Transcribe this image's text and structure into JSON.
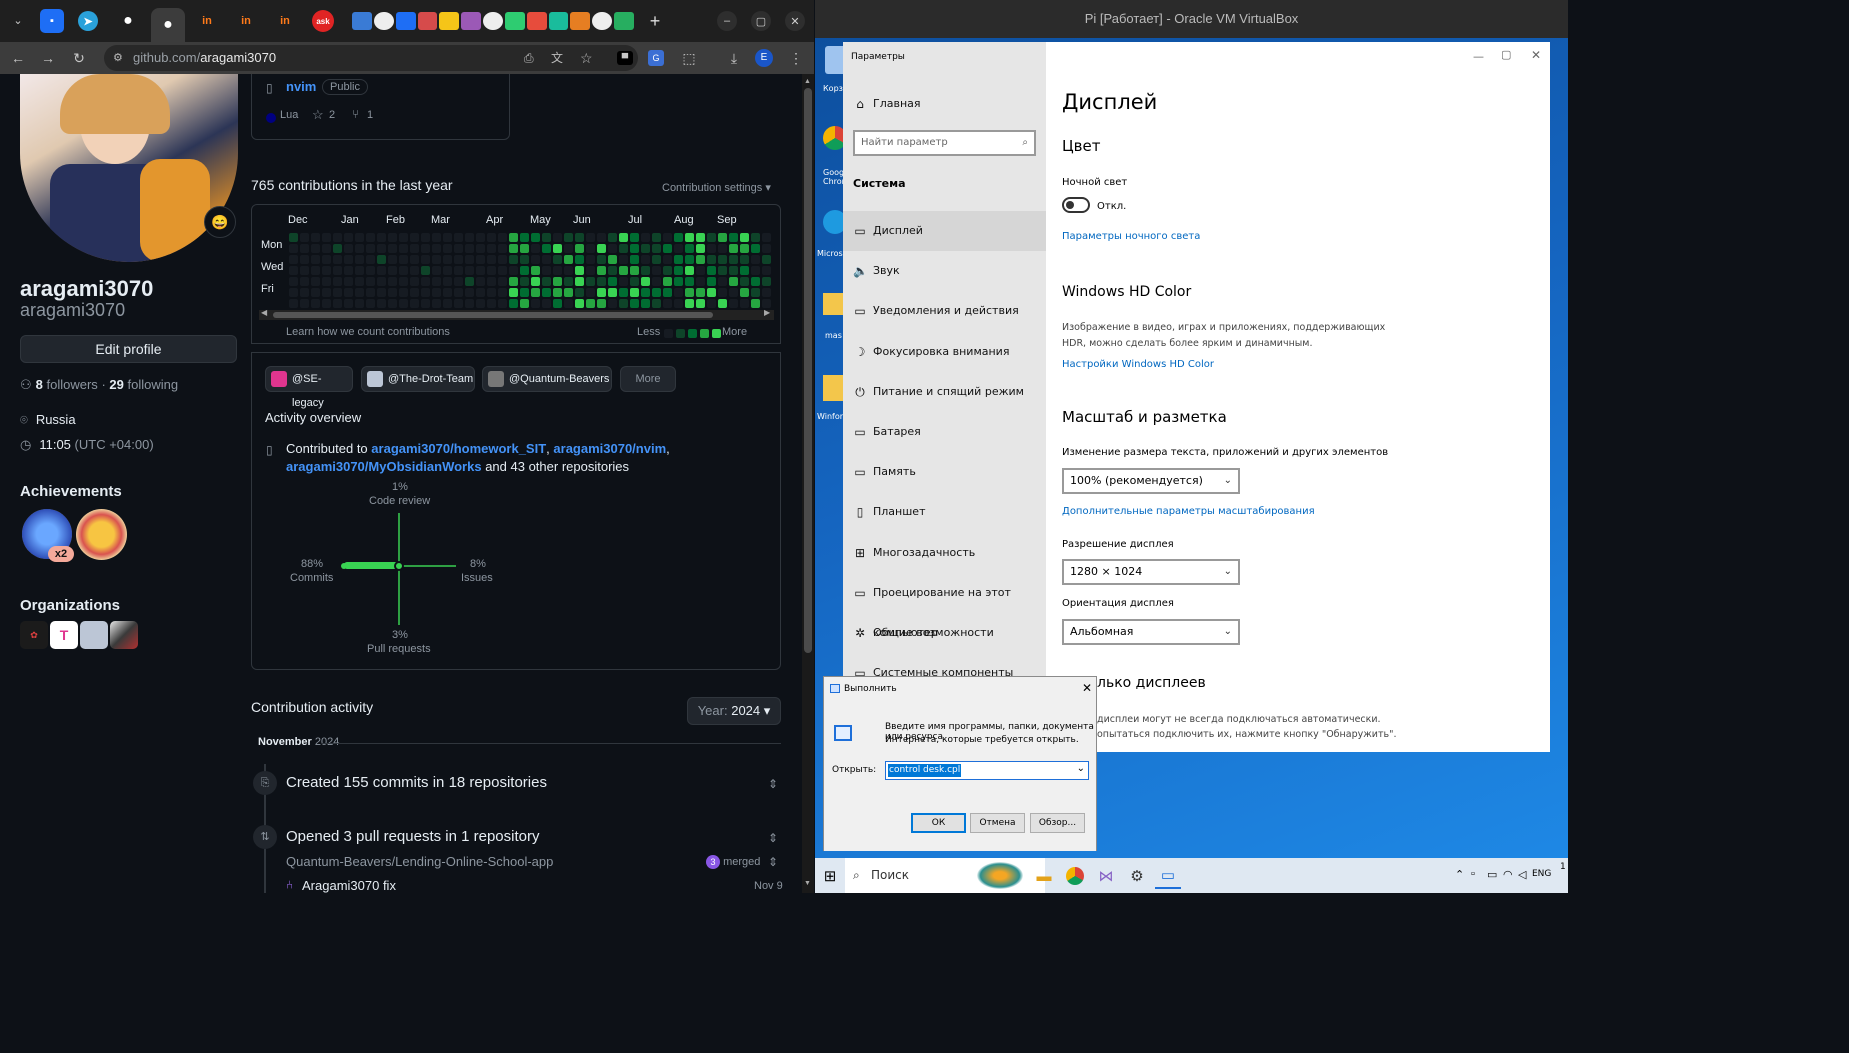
{
  "browser": {
    "url_host": "github.com/",
    "url_path": "aragami3070",
    "tab_favicons": [
      "chat",
      "telegram",
      "github",
      "github",
      "inf",
      "inf",
      "inf",
      "ask"
    ],
    "profile_initial": "E"
  },
  "pinned_repo": {
    "name": "nvim",
    "visibility": "Public",
    "language": "Lua",
    "stars": "2",
    "forks": "1"
  },
  "profile": {
    "name": "aragami3070",
    "login": "aragami3070",
    "edit_button": "Edit profile",
    "followers_count": "8",
    "followers_label": "followers",
    "separator": "·",
    "following_count": "29",
    "following_label": "following",
    "location": "Russia",
    "time": "11:05",
    "timezone": "(UTC +04:00)",
    "status_emoji": "😄"
  },
  "achievements": {
    "title": "Achievements",
    "badge_multiplier": "x2"
  },
  "organizations": {
    "title": "Organizations"
  },
  "contributions": {
    "summary": "765 contributions in the last year",
    "settings": "Contribution settings",
    "months": [
      "Dec",
      "Jan",
      "Feb",
      "Mar",
      "Apr",
      "May",
      "Jun",
      "Jul",
      "Aug",
      "Sep"
    ],
    "days": [
      "Mon",
      "Wed",
      "Fri"
    ],
    "learn_link": "Learn how we count contributions",
    "less": "Less",
    "more": "More"
  },
  "org_filters": [
    "@SE-legacy",
    "@The-Drot-Team",
    "@Quantum-Beavers"
  ],
  "org_more": "More",
  "activity_overview": {
    "title": "Activity overview",
    "contributed_prefix": "Contributed to",
    "repo1": "aragami3070/homework_SIT",
    "comma": ",",
    "repo2": "aragami3070/nvim",
    "repo3": "aragami3070/MyObsidianWorks",
    "suffix": "and 43 other repositories",
    "code_review_pct": "1%",
    "code_review_label": "Code review",
    "commits_pct": "88%",
    "commits_label": "Commits",
    "issues_pct": "8%",
    "issues_label": "Issues",
    "pr_pct": "3%",
    "pr_label": "Pull requests"
  },
  "contribution_activity": {
    "title": "Contribution activity",
    "year_prefix": "Year:",
    "year": "2024",
    "month": "November",
    "month_year": "2024",
    "item1": "Created 155 commits in 18 repositories",
    "item2": "Opened 3 pull requests in 1 repository",
    "repo": "Quantum-Beavers/Lending-Online-School-app",
    "merged_count": "3",
    "merged_label": "merged",
    "pr_title": "Aragami3070 fix",
    "pr_date": "Nov 9"
  },
  "vbox": {
    "title": "Pi [Работает] - Oracle VM VirtualBox",
    "desktop_icons": [
      "Корзи",
      "Googl Chrom",
      "Microso",
      "mas",
      "Winform"
    ]
  },
  "settings": {
    "window_title": "Параметры",
    "home": "Главная",
    "search_placeholder": "Найти параметр",
    "group": "Система",
    "nav": [
      "Дисплей",
      "Звук",
      "Уведомления и действия",
      "Фокусировка внимания",
      "Питание и спящий режим",
      "Батарея",
      "Память",
      "Планшет",
      "Многозадачность",
      "Проецирование на этот компьютер",
      "Общие возможности",
      "Системные компоненты"
    ],
    "page_title": "Дисплей",
    "color_heading": "Цвет",
    "night_light_label": "Ночной свет",
    "night_light_state": "Откл.",
    "night_light_link": "Параметры ночного света",
    "hdr_heading": "Windows HD Color",
    "hdr_desc1": "Изображение в видео, играх и приложениях, поддерживающих",
    "hdr_desc2": "HDR, можно сделать более ярким и динамичным.",
    "hdr_link": "Настройки Windows HD Color",
    "scale_heading": "Масштаб и разметка",
    "scale_label": "Изменение размера текста, приложений и других элементов",
    "scale_value": "100% (рекомендуется)",
    "scale_link": "Дополнительные параметры масштабирования",
    "resolution_label": "Разрешение дисплея",
    "resolution_value": "1280 × 1024",
    "orientation_label": "Ориентация дисплея",
    "orientation_value": "Альбомная",
    "multi_heading": "лько дисплеев",
    "multi_desc1": "дисплеи могут не всегда подключаться автоматически.",
    "multi_desc2": "опытаться подключить их, нажмите кнопку \"Обнаружить\"."
  },
  "run": {
    "title": "Выполнить",
    "desc1": "Введите имя программы, папки, документа или ресурса",
    "desc2": "Интернета, которые требуется открыть.",
    "open_label": "Открыть:",
    "value": "control desk.cpl",
    "ok": "ОК",
    "cancel": "Отмена",
    "browse": "Обзор..."
  },
  "taskbar": {
    "search": "Поиск",
    "lang": "ENG",
    "clock": "1"
  },
  "colors": {
    "accent": "#4493f8",
    "green1": "#0e4429",
    "green2": "#006d32",
    "green3": "#26a641",
    "green4": "#39d353"
  }
}
